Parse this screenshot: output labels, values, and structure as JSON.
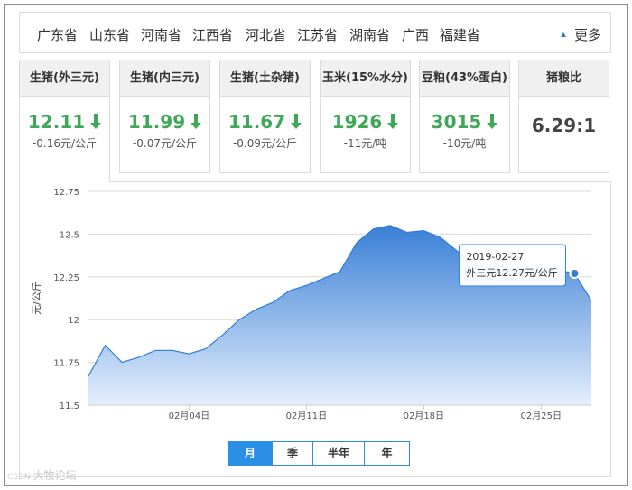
{
  "provinces": [
    "广东省",
    "山东省",
    "河南省",
    "江西省",
    "河北省",
    "江苏省",
    "湖南省",
    "广西",
    "福建省"
  ],
  "more_label": "更多",
  "cards": [
    {
      "title": "生猪(外三元)",
      "price": "12.11",
      "change": "-0.16元/公斤"
    },
    {
      "title": "生猪(内三元)",
      "price": "11.99",
      "change": "-0.07元/公斤"
    },
    {
      "title": "生猪(土杂猪)",
      "price": "11.67",
      "change": "-0.09元/公斤"
    },
    {
      "title": "玉米(15%水分)",
      "price": "1926",
      "change": "-11元/吨"
    },
    {
      "title": "豆粕(43%蛋白)",
      "price": "3015",
      "change": "-10元/吨"
    }
  ],
  "ratio_card": {
    "title": "猪粮比",
    "value": "6.29:1"
  },
  "colors": {
    "accent": "#2b8fe6",
    "down": "#3fa856",
    "area_top": "#3a7fd6",
    "area_bottom": "#e4effc"
  },
  "chart_data": {
    "type": "area",
    "ylabel": "元/公斤",
    "ylim": [
      11.5,
      12.75
    ],
    "yticks": [
      "12.75",
      "12.5",
      "12.25",
      "12",
      "11.75",
      "11.5"
    ],
    "xticks": [
      "02月04日",
      "02月11日",
      "02月18日",
      "02月25日"
    ],
    "x": [
      "01-29",
      "01-30",
      "01-31",
      "02-01",
      "02-02",
      "02-03",
      "02-04",
      "02-05",
      "02-06",
      "02-07",
      "02-08",
      "02-09",
      "02-10",
      "02-11",
      "02-12",
      "02-13",
      "02-14",
      "02-15",
      "02-16",
      "02-17",
      "02-18",
      "02-19",
      "02-20",
      "02-21",
      "02-22",
      "02-23",
      "02-24",
      "02-25",
      "02-26",
      "02-27",
      "02-28"
    ],
    "values": [
      11.67,
      11.85,
      11.75,
      11.78,
      11.82,
      11.82,
      11.8,
      11.83,
      11.91,
      12.0,
      12.06,
      12.1,
      12.17,
      12.2,
      12.24,
      12.28,
      12.45,
      12.53,
      12.55,
      12.51,
      12.52,
      12.48,
      12.4,
      12.33,
      12.32,
      12.3,
      12.3,
      12.31,
      12.29,
      12.27,
      12.11
    ],
    "grid": true,
    "tooltip": {
      "date": "2019-02-27",
      "text": "外三元12.27元/公斤"
    }
  },
  "period_tabs": [
    "月",
    "季",
    "半年",
    "年"
  ],
  "watermark": "大牧论坛",
  "watermark_logo": "CSDN"
}
